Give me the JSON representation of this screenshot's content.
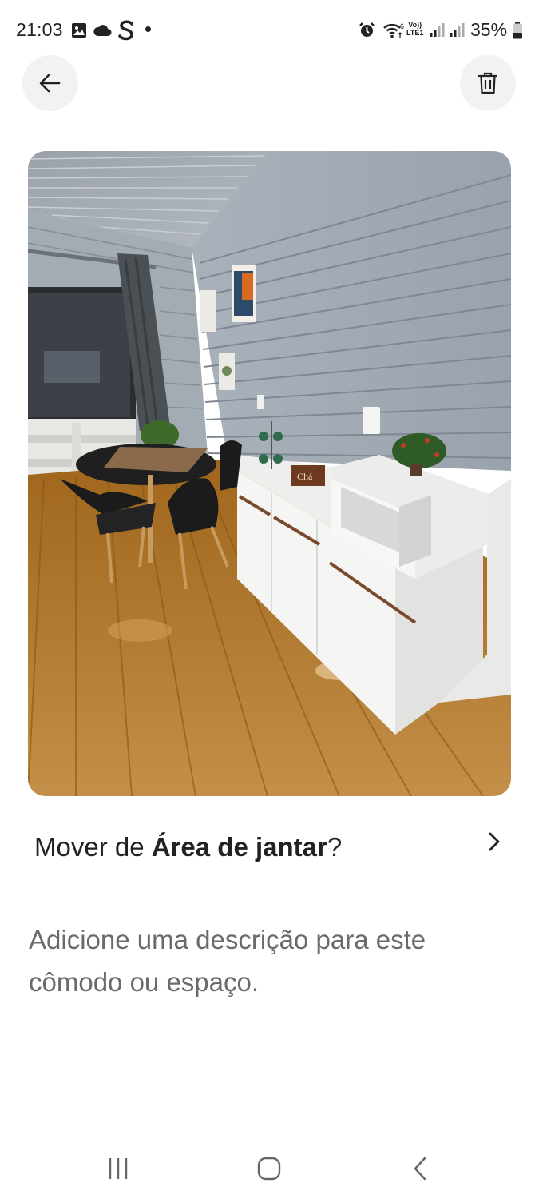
{
  "status_bar": {
    "time": "21:03",
    "network_label_top": "Vo))",
    "network_label_bottom": "LTE1",
    "battery": "35%",
    "icons": [
      "gallery-icon",
      "cloud-icon",
      "s-app-icon",
      "notification-dot",
      "alarm-icon",
      "wifi-icon",
      "signal-icon",
      "battery-icon"
    ]
  },
  "header": {
    "back_icon": "arrow-left-icon",
    "delete_icon": "trash-icon"
  },
  "photo": {
    "subject": "dining-area-room-photo",
    "label": "Chá"
  },
  "move": {
    "prefix": "Mover de ",
    "room": "Área de jantar",
    "suffix": "?",
    "icon": "chevron-right-icon"
  },
  "description": {
    "placeholder": "Adicione uma descrição para este cômodo ou espaço."
  },
  "nav": {
    "icons": [
      "recent-apps-icon",
      "home-icon",
      "back-icon"
    ]
  },
  "colors": {
    "button_bg": "#f2f2f2",
    "divider": "#dddddd",
    "placeholder_text": "#6a6a6a",
    "text": "#222222"
  }
}
